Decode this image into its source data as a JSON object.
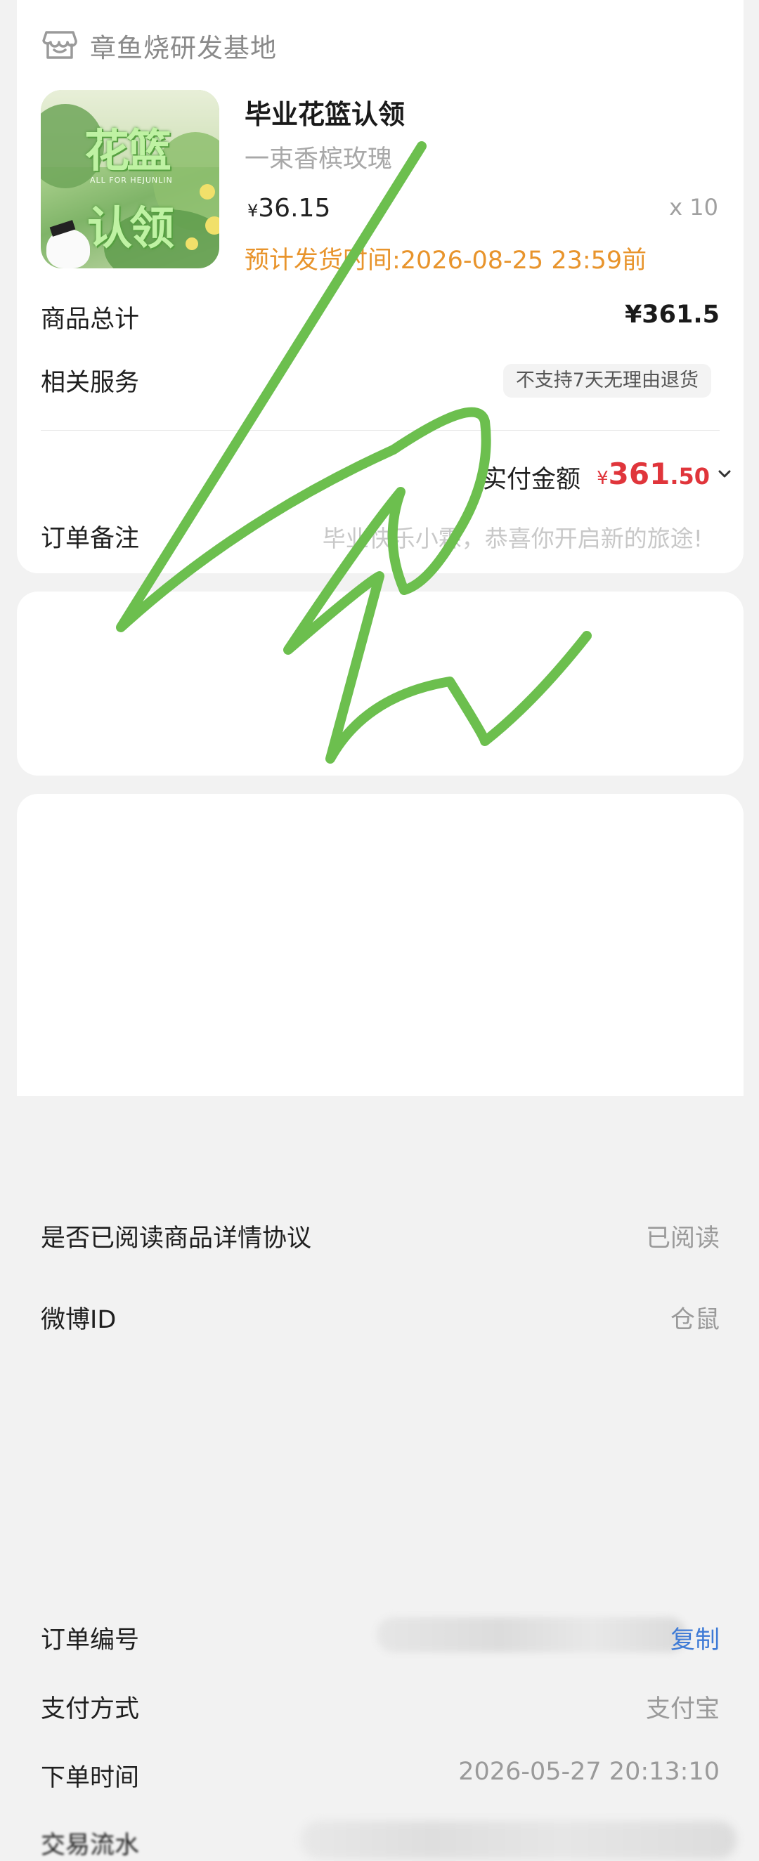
{
  "shop": {
    "name": "章鱼烧研发基地",
    "icon": "storefront-icon"
  },
  "product": {
    "title": "毕业花篮认领",
    "variant": "一束香槟玫瑰",
    "price_symbol": "¥",
    "price": "36.15",
    "quantity": "x 10",
    "ship_time": "预计发货时间:2026-08-25 23:59前",
    "image": {
      "title_line1": "花篮",
      "title_line2": "认领",
      "subtitle": "ALL FOR HEJUNLIN"
    }
  },
  "summary": {
    "total_label": "商品总计",
    "total_value": "¥361.5",
    "service_label": "相关服务",
    "service_badge": "不支持7天无理由退货",
    "paid_label": "实付金额",
    "paid_symbol": "¥",
    "paid_int": "361",
    "paid_dec": ".50",
    "note_label": "订单备注",
    "note_value": "毕业快乐小霖，恭喜你开启新的旅途!"
  },
  "extra": {
    "read_label": "是否已阅读商品详情协议",
    "read_value": "已阅读",
    "weibo_label": "微博ID",
    "weibo_value": "仓鼠"
  },
  "order": {
    "number_label": "订单编号",
    "copy_label": "复制",
    "pay_label": "支付方式",
    "pay_value": "支付宝",
    "time_label": "下单时间",
    "time_value": "2026-05-27 20:13:10",
    "flow_label": "交易流水"
  },
  "colors": {
    "price_red": "#e0353b",
    "ship_orange": "#e8942c",
    "copy_blue": "#3f7bd6",
    "scribble_green": "#6cbf4e"
  }
}
